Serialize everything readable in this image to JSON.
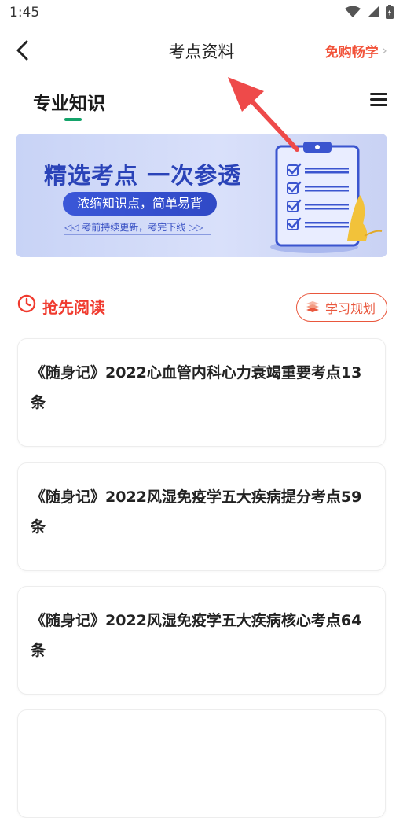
{
  "status_bar": {
    "time": "1:45"
  },
  "navbar": {
    "title": "考点资料",
    "free_buy": "免购畅学",
    "free_buy_chevron": "›"
  },
  "section": {
    "title": "专业知识"
  },
  "banner": {
    "headline": "精选考点 一次参透",
    "pill": "浓缩知识点，简单易背",
    "sub": "◁◁ 考前持续更新，考完下线 ▷▷"
  },
  "read_section": {
    "title": "抢先阅读",
    "plan_button": "学习规划"
  },
  "cards": [
    {
      "title": "《随身记》2022心血管内科心力衰竭重要考点13条"
    },
    {
      "title": "《随身记》2022风湿免疫学五大疾病提分考点59条"
    },
    {
      "title": "《随身记》2022风湿免疫学五大疾病核心考点64条"
    }
  ],
  "colors": {
    "accent_red": "#f03a2e",
    "accent_green": "#14a36a",
    "banner_blue": "#2a43b8",
    "annotation_arrow": "#ee4a4a"
  },
  "icons": {
    "status": [
      "wifi-icon",
      "signal-icon",
      "battery-icon"
    ],
    "back": "chevron-left-icon",
    "menu": "menu-icon",
    "clock": "clock-icon",
    "plan": "book-icon",
    "banner": "clipboard-checklist-icon"
  }
}
